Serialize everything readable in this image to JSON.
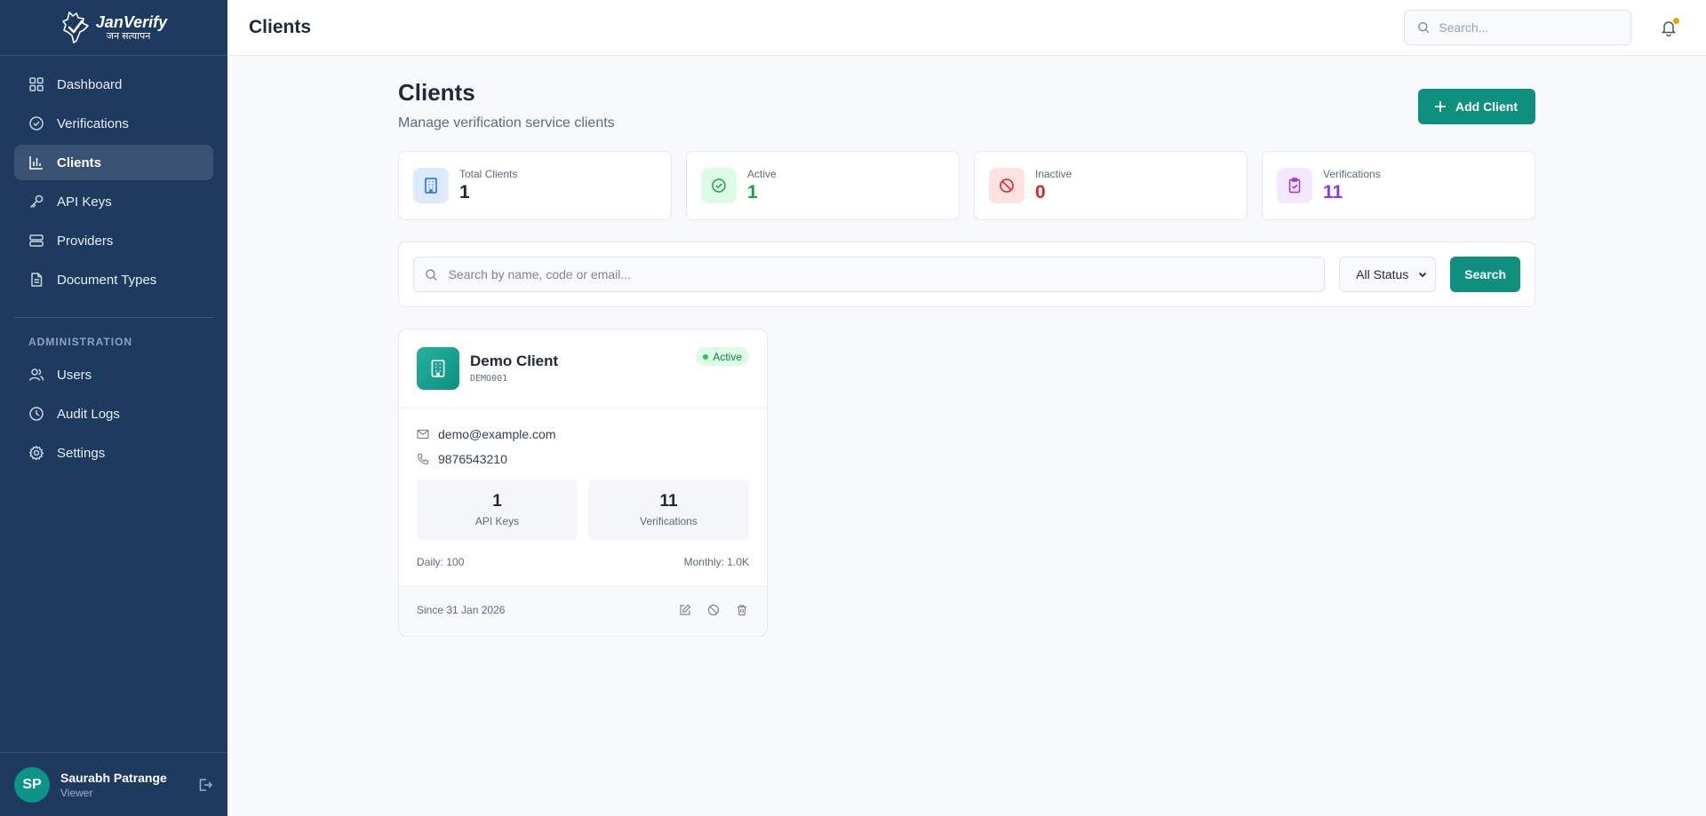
{
  "brand": {
    "name": "JanVerify",
    "tagline": "जन सत्यापन"
  },
  "sidebar": {
    "items": [
      {
        "label": "Dashboard",
        "icon": "grid-icon"
      },
      {
        "label": "Verifications",
        "icon": "check-circle-icon"
      },
      {
        "label": "Clients",
        "icon": "bar-chart-icon",
        "active": true
      },
      {
        "label": "API Keys",
        "icon": "key-icon"
      },
      {
        "label": "Providers",
        "icon": "database-icon"
      },
      {
        "label": "Document Types",
        "icon": "file-icon"
      }
    ],
    "admin_section": "ADMINISTRATION",
    "admin_items": [
      {
        "label": "Users",
        "icon": "users-icon"
      },
      {
        "label": "Audit Logs",
        "icon": "clock-icon"
      },
      {
        "label": "Settings",
        "icon": "gear-icon"
      }
    ]
  },
  "user": {
    "initials": "SP",
    "name": "Saurabh Patrange",
    "role": "Viewer"
  },
  "topbar": {
    "title": "Clients",
    "search_placeholder": "Search..."
  },
  "page": {
    "title": "Clients",
    "subtitle": "Manage verification service clients",
    "add_button": "Add Client"
  },
  "stats": [
    {
      "label": "Total Clients",
      "value": "1",
      "color": "#1e293b",
      "bg": "#dbeafe",
      "icon_color": "#2563eb"
    },
    {
      "label": "Active",
      "value": "1",
      "color": "#16a34a",
      "bg": "#dcfce7",
      "icon_color": "#16a34a"
    },
    {
      "label": "Inactive",
      "value": "0",
      "color": "#dc2626",
      "bg": "#fee2e2",
      "icon_color": "#dc2626"
    },
    {
      "label": "Verifications",
      "value": "11",
      "color": "#9333ea",
      "bg": "#f3e8ff",
      "icon_color": "#9333ea"
    }
  ],
  "filters": {
    "search_placeholder": "Search by name, code or email...",
    "status_selected": "All Status",
    "search_button": "Search"
  },
  "client": {
    "name": "Demo Client",
    "code": "DEMO001",
    "status": "Active",
    "email": "demo@example.com",
    "phone": "9876543210",
    "api_keys_value": "1",
    "api_keys_label": "API Keys",
    "verifications_value": "11",
    "verifications_label": "Verifications",
    "daily": "Daily: 100",
    "monthly": "Monthly: 1.0K",
    "since": "Since 31 Jan 2026"
  },
  "colors": {
    "sidebar": "#1e3a5f",
    "accent": "#0f8f7e",
    "notification_dot": "#f59e0b"
  }
}
